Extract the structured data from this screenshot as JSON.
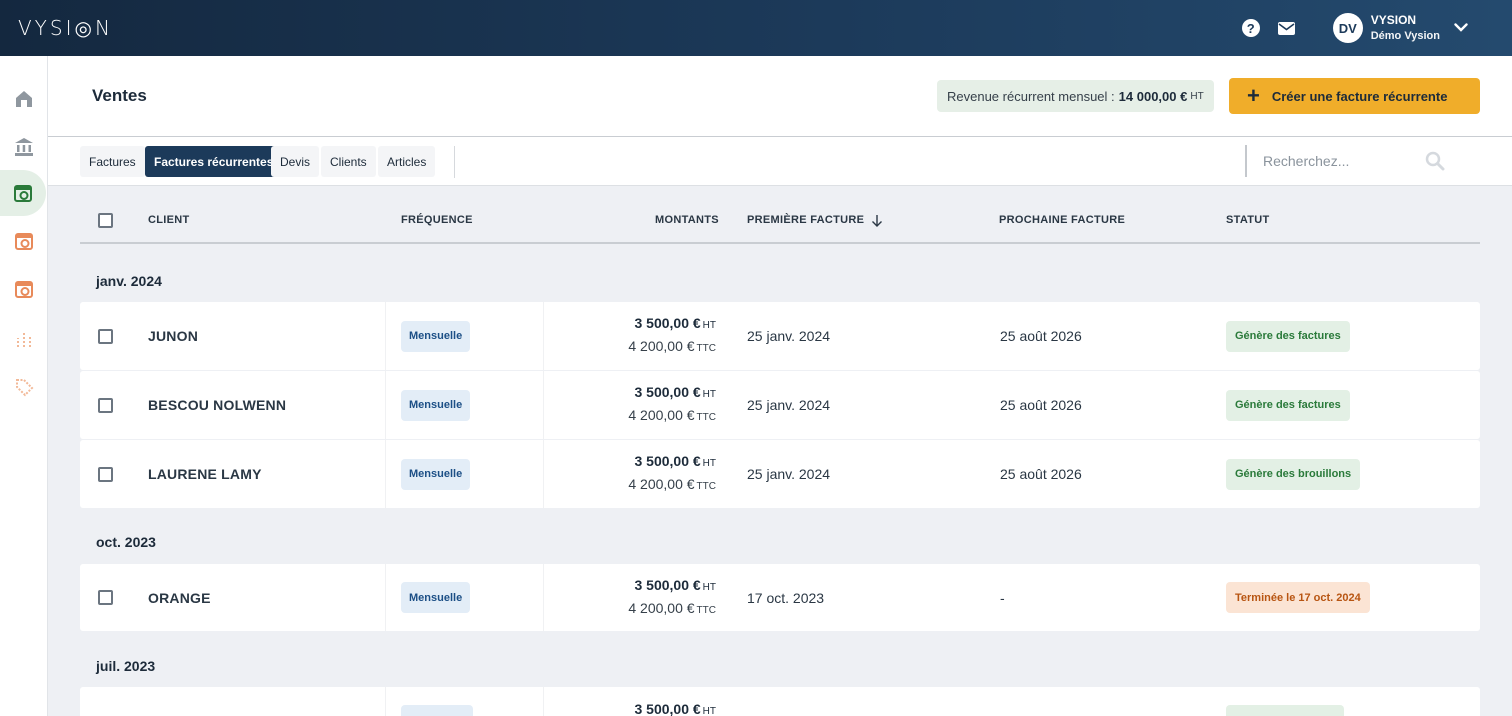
{
  "app": {
    "logo": "VYSI◎N",
    "help_icon": "question-icon",
    "mail_icon": "mail-icon",
    "avatar_initials": "DV",
    "user_name": "VYSION",
    "user_org": "Démo Vysion"
  },
  "sidebar": {
    "items": [
      {
        "icon": "home-icon"
      },
      {
        "icon": "bank-icon"
      },
      {
        "icon": "invoice-recurring-icon",
        "active": true
      },
      {
        "icon": "invoice-icon"
      },
      {
        "icon": "invoice-alt-icon"
      },
      {
        "icon": "chart-icon"
      },
      {
        "icon": "tag-icon"
      }
    ]
  },
  "header": {
    "title": "Ventes",
    "revenue_label": "Revenue récurrent mensuel :",
    "revenue_value": "14 000,00 €",
    "revenue_unit": "HT",
    "create_button": "Créer une facture récurrente"
  },
  "tabs": {
    "items": [
      "Factures",
      "Factures récurrentes",
      "Devis",
      "Clients",
      "Articles"
    ],
    "active": "Factures récurrentes"
  },
  "search": {
    "placeholder": "Recherchez..."
  },
  "table": {
    "columns": {
      "client": "CLIENT",
      "frequency": "FRÉQUENCE",
      "amounts": "MONTANTS",
      "first_invoice": "PREMIÈRE FACTURE",
      "next_invoice": "PROCHAINE FACTURE",
      "status": "STATUT"
    },
    "groups": [
      {
        "label": "janv. 2024",
        "rows": [
          {
            "client": "JUNON",
            "frequency": "Mensuelle",
            "amount_ht": "3 500,00 €",
            "amount_ttc": "4 200,00 €",
            "unit_ht": "HT",
            "unit_ttc": "TTC",
            "first": "25 janv. 2024",
            "next": "25 août 2026",
            "status": "Génère des factures",
            "status_color": "green"
          },
          {
            "client": "BESCOU NOLWENN",
            "frequency": "Mensuelle",
            "amount_ht": "3 500,00 €",
            "amount_ttc": "4 200,00 €",
            "unit_ht": "HT",
            "unit_ttc": "TTC",
            "first": "25 janv. 2024",
            "next": "25 août 2026",
            "status": "Génère des factures",
            "status_color": "green"
          },
          {
            "client": "LAURENE LAMY",
            "frequency": "Mensuelle",
            "amount_ht": "3 500,00 €",
            "amount_ttc": "4 200,00 €",
            "unit_ht": "HT",
            "unit_ttc": "TTC",
            "first": "25 janv. 2024",
            "next": "25 août 2026",
            "status": "Génère des brouillons",
            "status_color": "green"
          }
        ]
      },
      {
        "label": "oct. 2023",
        "rows": [
          {
            "client": "ORANGE",
            "frequency": "Mensuelle",
            "amount_ht": "3 500,00 €",
            "amount_ttc": "4 200,00 €",
            "unit_ht": "HT",
            "unit_ttc": "TTC",
            "first": "17 oct. 2023",
            "next": "-",
            "status": "Terminée le 17 oct. 2024",
            "status_color": "orange"
          }
        ]
      },
      {
        "label": "juil. 2023",
        "rows": [
          {
            "client": "",
            "frequency": "",
            "amount_ht": "3 500,00 €",
            "amount_ttc": "",
            "unit_ht": "HT",
            "unit_ttc": "",
            "first": "",
            "next": "",
            "status": "",
            "status_color": "green"
          }
        ]
      }
    ]
  },
  "colors": {
    "topbar": "#1c3a5a",
    "accent": "#f0ad2a",
    "active_tab": "#1c3a5a",
    "status_green_bg": "#e3f0e5",
    "status_orange_bg": "#fbe4d4"
  }
}
